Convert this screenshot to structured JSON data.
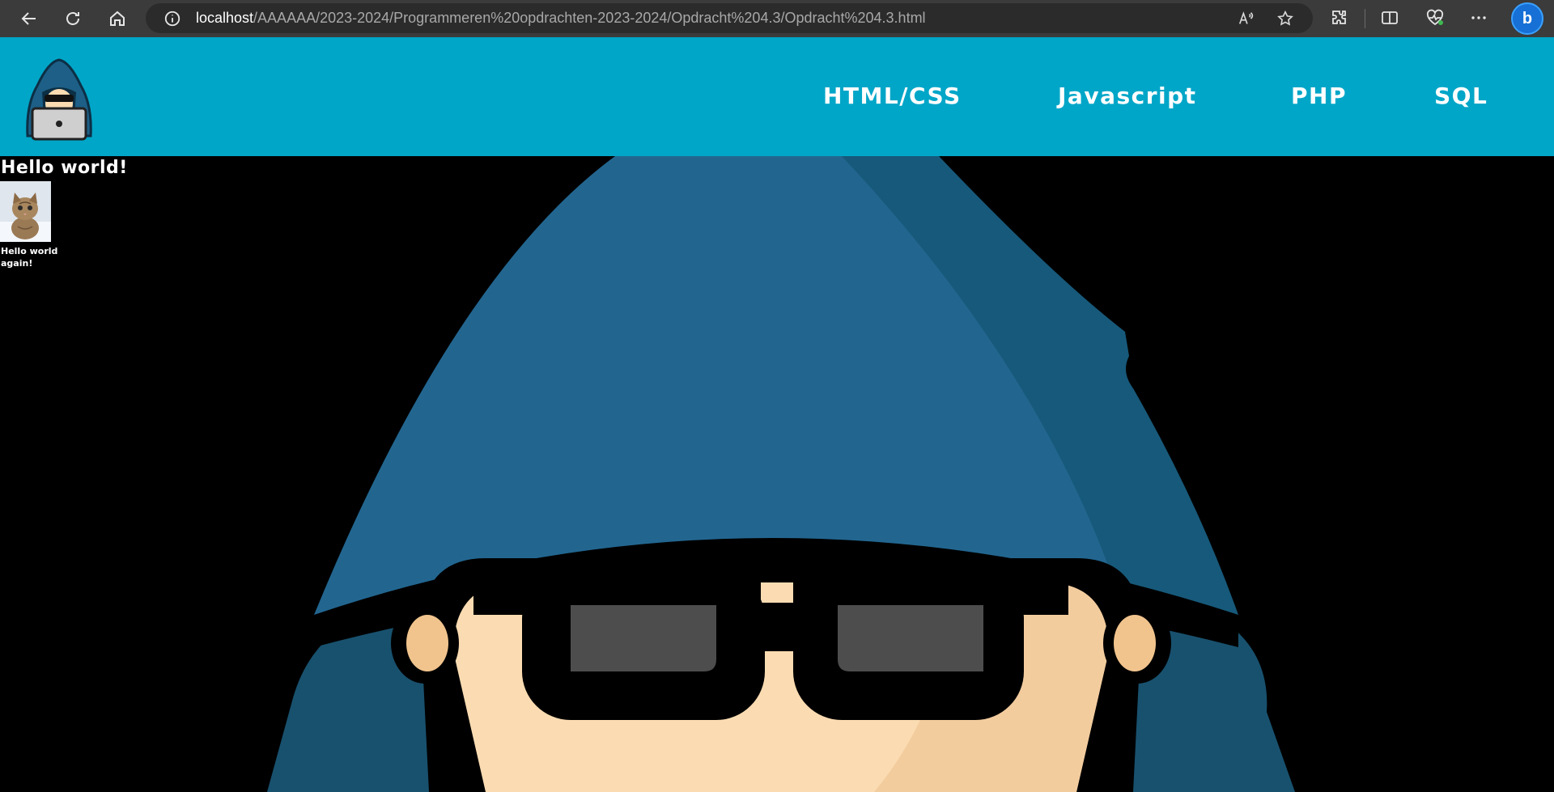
{
  "browser": {
    "url_host": "localhost",
    "url_path": "/AAAAAA/2023-2024/Programmeren%20opdrachten-2023-2024/Opdracht%204.3/Opdracht%204.3.html",
    "icons": {
      "back": "back-arrow-icon",
      "refresh": "refresh-icon",
      "home": "home-icon",
      "site_info": "info-icon",
      "read_aloud": "read-aloud-icon",
      "favorite": "star-icon",
      "extensions": "puzzle-icon",
      "split_screen": "split-screen-icon",
      "browser_essentials": "heart-pulse-icon",
      "more": "more-dots-icon",
      "copilot": "bing-copilot-icon"
    },
    "copilot_letter": "b"
  },
  "header": {
    "background_color": "#00a6c8",
    "logo_icon": "hacker-logo-icon",
    "nav": [
      "HTML/CSS",
      "Javascript",
      "PHP",
      "SQL"
    ]
  },
  "main": {
    "heading": "Hello world!",
    "image_icon": "kitten-image",
    "subtext": "Hello world again!",
    "background_icon": "hacker-background-image"
  }
}
